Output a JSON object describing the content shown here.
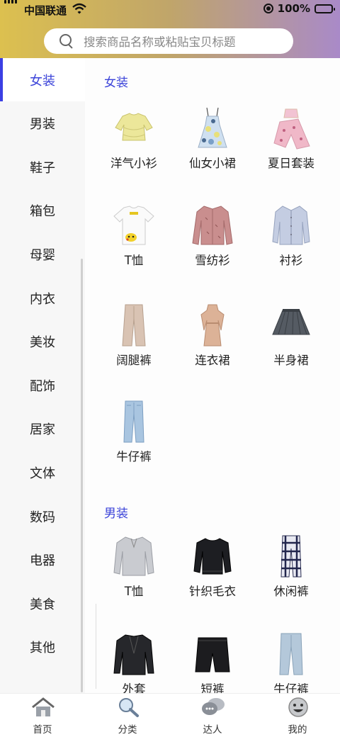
{
  "status_bar": {
    "carrier": "中国联通",
    "battery": "100%"
  },
  "search": {
    "placeholder": "搜索商品名称或粘贴宝贝标题"
  },
  "sidebar": {
    "active": 0,
    "items": [
      {
        "label": "女装"
      },
      {
        "label": "男装"
      },
      {
        "label": "鞋子"
      },
      {
        "label": "箱包"
      },
      {
        "label": "母婴"
      },
      {
        "label": "内衣"
      },
      {
        "label": "美妆"
      },
      {
        "label": "配饰"
      },
      {
        "label": "居家"
      },
      {
        "label": "文体"
      },
      {
        "label": "数码"
      },
      {
        "label": "电器"
      },
      {
        "label": "美食"
      },
      {
        "label": "其他"
      }
    ]
  },
  "sections": [
    {
      "title": "女装",
      "items": [
        {
          "label": "洋气小衫",
          "icon": "yellow-blouse-icon"
        },
        {
          "label": "仙女小裙",
          "icon": "floral-dress-icon"
        },
        {
          "label": "夏日套装",
          "icon": "summer-set-icon"
        },
        {
          "label": "T恤",
          "icon": "white-tshirt-icon"
        },
        {
          "label": "雪纺衫",
          "icon": "chiffon-shirt-icon"
        },
        {
          "label": "衬衫",
          "icon": "shirt-icon"
        },
        {
          "label": "阔腿裤",
          "icon": "wide-pants-icon"
        },
        {
          "label": "连衣裙",
          "icon": "knit-dress-icon"
        },
        {
          "label": "半身裙",
          "icon": "pleated-skirt-icon"
        },
        {
          "label": "牛仔裤",
          "icon": "jeans-icon"
        }
      ]
    },
    {
      "title": "男装",
      "items": [
        {
          "label": "T恤",
          "icon": "grey-polo-icon"
        },
        {
          "label": "针织毛衣",
          "icon": "black-sweater-icon"
        },
        {
          "label": "休闲裤",
          "icon": "plaid-pants-icon"
        },
        {
          "label": "外套",
          "icon": "blazer-icon"
        },
        {
          "label": "短裤",
          "icon": "shorts-icon"
        },
        {
          "label": "牛仔裤",
          "icon": "mens-jeans-icon"
        }
      ]
    }
  ],
  "tabbar": [
    {
      "label": "首页",
      "icon": "home-icon"
    },
    {
      "label": "分类",
      "icon": "magnifier-icon"
    },
    {
      "label": "达人",
      "icon": "chat-bubbles-icon"
    },
    {
      "label": "我的",
      "icon": "smiley-icon"
    }
  ],
  "colors": {
    "accent": "#3b43d9",
    "header_left": "#dcc04f",
    "header_right": "#a98ac8"
  }
}
